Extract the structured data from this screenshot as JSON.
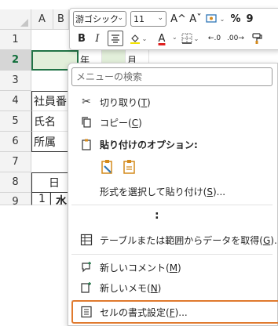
{
  "sheet": {
    "col_a": "A",
    "col_b": "B",
    "rows": [
      "1",
      "2",
      "3",
      "4",
      "5",
      "6",
      "7",
      "8",
      "9"
    ],
    "cells": {
      "b2": "年",
      "c2": "月",
      "a4": "社員番",
      "a5": "氏名",
      "a6": "所属",
      "b8": "日",
      "a9": "1",
      "b9": "水"
    }
  },
  "mini_toolbar": {
    "font_name": "游ゴシック",
    "font_size": "11",
    "grow_font": "A^",
    "shrink_font": "Aˇ",
    "percent": "%",
    "comma": "9",
    "bold": "B",
    "italic": "I",
    "font_color": "A",
    "inc_decimal": "←.0",
    "dec_decimal": ".00→"
  },
  "menu": {
    "search_placeholder": "メニューの検索",
    "items": {
      "cut": {
        "label": "切り取り(",
        "key": "T",
        "suffix": ")"
      },
      "copy": {
        "label": "コピー(",
        "key": "C",
        "suffix": ")"
      },
      "paste_options": {
        "label": "貼り付けのオプション:"
      },
      "paste_special": {
        "label": "形式を選択して貼り付け(",
        "key": "S",
        "suffix": ")..."
      },
      "more": ":",
      "get_data": {
        "label": "テーブルまたは範囲からデータを取得(",
        "key": "G",
        "suffix": ")..."
      },
      "new_comment": {
        "label": "新しいコメント(",
        "key": "M",
        "suffix": ")"
      },
      "new_note": {
        "label": "新しいメモ(",
        "key": "N",
        "suffix": ")"
      },
      "format_cells": {
        "label": "セルの書式設定(",
        "key": "F",
        "suffix": ")..."
      }
    }
  },
  "colors": {
    "accent_green": "#217346",
    "highlight_orange": "#e07a2e",
    "paste_icon_orange": "#d48a1c"
  }
}
